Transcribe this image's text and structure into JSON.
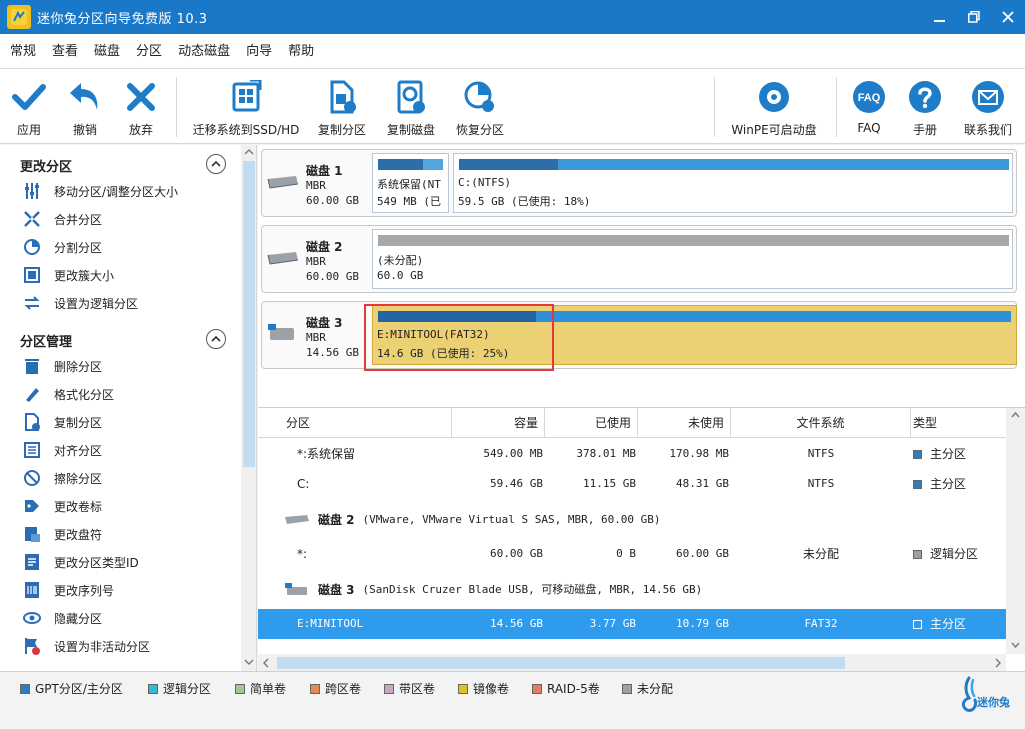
{
  "window": {
    "title": "迷你兔分区向导免费版 10.3"
  },
  "menu": [
    "常规",
    "查看",
    "磁盘",
    "分区",
    "动态磁盘",
    "向导",
    "帮助"
  ],
  "toolbar": {
    "apply": "应用",
    "undo": "撤销",
    "discard": "放弃",
    "migrate": "迁移系统到SSD/HD",
    "copy_partition": "复制分区",
    "copy_disk": "复制磁盘",
    "recover_partition": "恢复分区",
    "winpe": "WinPE可启动盘",
    "faq": "FAQ",
    "manual": "手册",
    "contact": "联系我们",
    "faq_icon_text": "FAQ"
  },
  "left_panel": {
    "change_partition": {
      "title": "更改分区",
      "items": [
        "移动分区/调整分区大小",
        "合并分区",
        "分割分区",
        "更改簇大小",
        "设置为逻辑分区"
      ]
    },
    "partition_management": {
      "title": "分区管理",
      "items": [
        "删除分区",
        "格式化分区",
        "复制分区",
        "对齐分区",
        "擦除分区",
        "更改卷标",
        "更改盘符",
        "更改分区类型ID",
        "更改序列号",
        "隐藏分区",
        "设置为非活动分区"
      ]
    }
  },
  "disks": [
    {
      "name": "磁盘 1",
      "type": "MBR",
      "size": "60.00 GB",
      "partitions": [
        {
          "name": "系统保留(NT",
          "usage": "549 MB (已",
          "used_fraction": 0.69,
          "color": "#2d7fc1"
        },
        {
          "name": "C:(NTFS)",
          "usage": "59.5 GB (已使用: 18%)",
          "used_fraction": 0.18,
          "color": "#2d7fc1"
        }
      ]
    },
    {
      "name": "磁盘 2",
      "type": "MBR",
      "size": "60.00 GB",
      "partitions": [
        {
          "name": "(未分配)",
          "usage": "60.0 GB",
          "used_fraction": 0,
          "color": "#a8a8a8"
        }
      ]
    },
    {
      "name": "磁盘 3",
      "type": "MBR",
      "size": "14.56 GB",
      "partitions": [
        {
          "name": "E:MINITOOL(FAT32)",
          "usage": "14.6 GB (已使用: 25%)",
          "used_fraction": 0.25,
          "color": "#2d7fc1"
        }
      ]
    }
  ],
  "table": {
    "columns": [
      "分区",
      "容量",
      "已使用",
      "未使用",
      "文件系统",
      "类型"
    ],
    "rows": [
      {
        "partition": "*:系统保留",
        "capacity": "549.00 MB",
        "used": "378.01 MB",
        "unused": "170.98 MB",
        "fs": "NTFS",
        "type": "主分区",
        "type_color": "#2d7fc1"
      },
      {
        "partition": "C:",
        "capacity": "59.46 GB",
        "used": "11.15 GB",
        "unused": "48.31 GB",
        "fs": "NTFS",
        "type": "主分区",
        "type_color": "#2d7fc1"
      },
      {
        "partition": "*:",
        "capacity": "60.00 GB",
        "used": "0 B",
        "unused": "60.00 GB",
        "fs": "未分配",
        "type": "逻辑分区",
        "type_color": "#a0a0a0"
      },
      {
        "partition": "E:MINITOOL",
        "capacity": "14.56 GB",
        "used": "3.77 GB",
        "unused": "10.79 GB",
        "fs": "FAT32",
        "type": "主分区",
        "type_color": "#2f9bec"
      }
    ],
    "disk_groups": [
      {
        "name": "磁盘 2",
        "desc": "(VMware, VMware Virtual S SAS, MBR, 60.00 GB)"
      },
      {
        "name": "磁盘 3",
        "desc": "(SanDisk Cruzer Blade USB, 可移动磁盘, MBR, 14.56 GB)"
      }
    ]
  },
  "legend": [
    {
      "label": "GPT分区/主分区",
      "color": "#2d7fc1"
    },
    {
      "label": "逻辑分区",
      "color": "#35b7d6"
    },
    {
      "label": "简单卷",
      "color": "#a3c98a"
    },
    {
      "label": "跨区卷",
      "color": "#e48a55"
    },
    {
      "label": "带区卷",
      "color": "#c9a6c6"
    },
    {
      "label": "镜像卷",
      "color": "#e0c020"
    },
    {
      "label": "RAID-5卷",
      "color": "#e08060"
    },
    {
      "label": "未分配",
      "color": "#a0a0a0"
    }
  ],
  "brand": "迷你兔"
}
